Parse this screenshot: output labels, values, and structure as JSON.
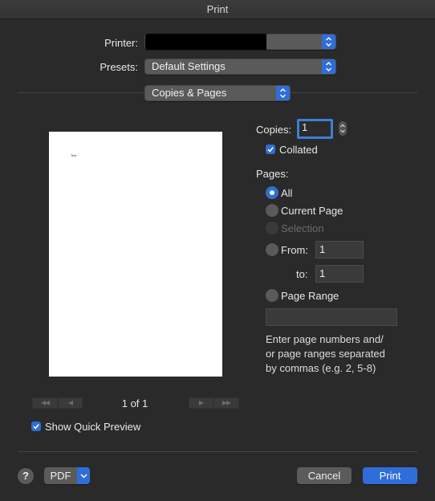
{
  "window": {
    "title": "Print"
  },
  "printer": {
    "label": "Printer:",
    "value": ""
  },
  "presets": {
    "label": "Presets:",
    "value": "Default Settings"
  },
  "section": {
    "value": "Copies & Pages"
  },
  "preview": {
    "page_text": "Text",
    "page_indicator": "1 of 1",
    "nav_first": "◀◀",
    "nav_prev": "◀",
    "nav_next": "▶",
    "nav_last": "▶▶"
  },
  "copies": {
    "label": "Copies:",
    "value": "1",
    "collated_label": "Collated",
    "collated": true
  },
  "pages": {
    "label": "Pages:",
    "all_label": "All",
    "current_label": "Current Page",
    "selection_label": "Selection",
    "from_label": "From:",
    "from_value": "1",
    "to_label": "to:",
    "to_value": "1",
    "range_label": "Page Range",
    "range_value": "",
    "hint": "Enter page numbers and/\nor page ranges separated\nby commas (e.g. 2, 5-8)",
    "selected": "All"
  },
  "quick_preview": {
    "label": "Show Quick Preview",
    "checked": true
  },
  "footer": {
    "help": "?",
    "pdf_label": "PDF",
    "cancel_label": "Cancel",
    "print_label": "Print"
  },
  "colors": {
    "accent": "#2f6ed8",
    "background": "#2a2a2a"
  }
}
